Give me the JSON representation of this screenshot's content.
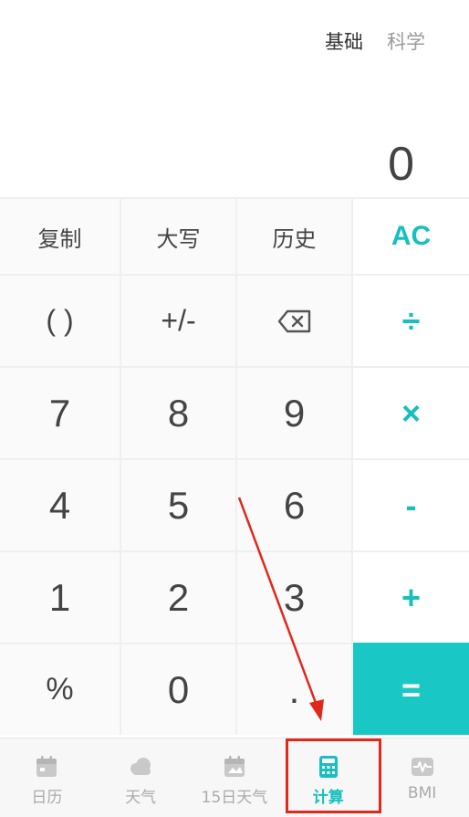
{
  "mode_tabs": {
    "basic": "基础",
    "scientific": "科学"
  },
  "display": {
    "value": "0"
  },
  "keys": {
    "row1": [
      "复制",
      "大写",
      "历史",
      "AC"
    ],
    "row2": [
      "( )",
      "+/-",
      "backspace-icon",
      "÷"
    ],
    "row3": [
      "7",
      "8",
      "9",
      "×"
    ],
    "row4": [
      "4",
      "5",
      "6",
      "-"
    ],
    "row5": [
      "1",
      "2",
      "3",
      "+"
    ],
    "row6": [
      "%",
      "0",
      ".",
      "="
    ]
  },
  "bottom_nav": [
    {
      "label": "日历",
      "icon": "calendar-icon"
    },
    {
      "label": "天气",
      "icon": "cloud-icon"
    },
    {
      "label": "15日天气",
      "icon": "calendar-weather-icon"
    },
    {
      "label": "计算",
      "icon": "calculator-icon",
      "active": true
    },
    {
      "label": "BMI",
      "icon": "heartbeat-icon"
    }
  ],
  "colors": {
    "accent": "#17c0be",
    "annotation": "#e0281c"
  }
}
